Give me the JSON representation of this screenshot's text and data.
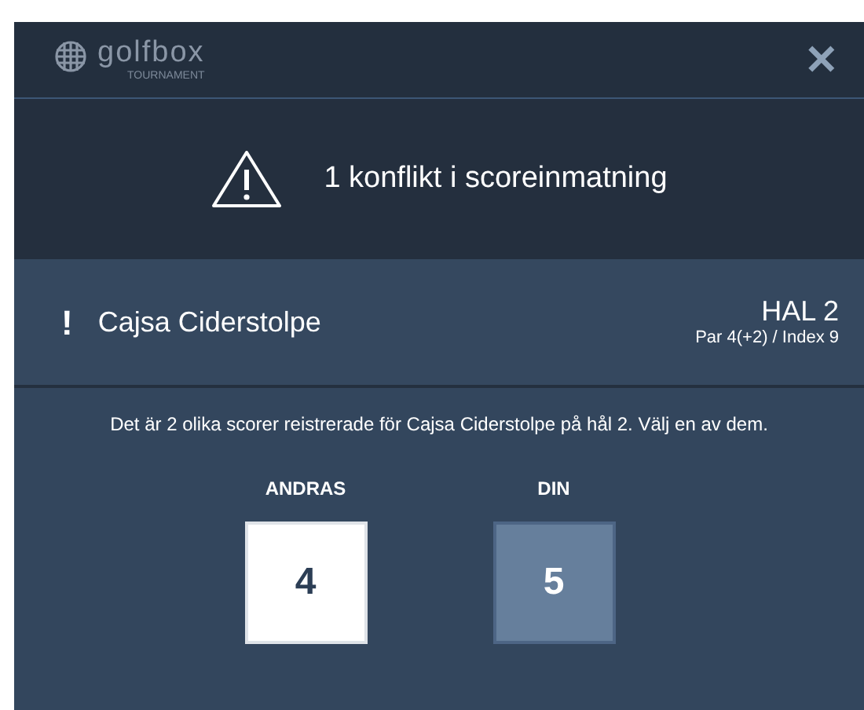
{
  "header": {
    "logo": "golfbox",
    "logo_sub": "TOURNAMENT",
    "close": "✕"
  },
  "banner": {
    "title": "1 konflikt i scoreinmatning"
  },
  "player": {
    "mark": "!",
    "name": "Cajsa Ciderstolpe",
    "hole": "HAL 2",
    "hole_info": "Par 4(+2) / Index 9"
  },
  "message": "Det är 2 olika scorer reistrerade för Cajsa Ciderstolpe på hål 2. Välj en av dem.",
  "options": [
    {
      "label": "ANDRAS",
      "score": "4",
      "selected": true
    },
    {
      "label": "DIN",
      "score": "5",
      "selected": false
    }
  ]
}
